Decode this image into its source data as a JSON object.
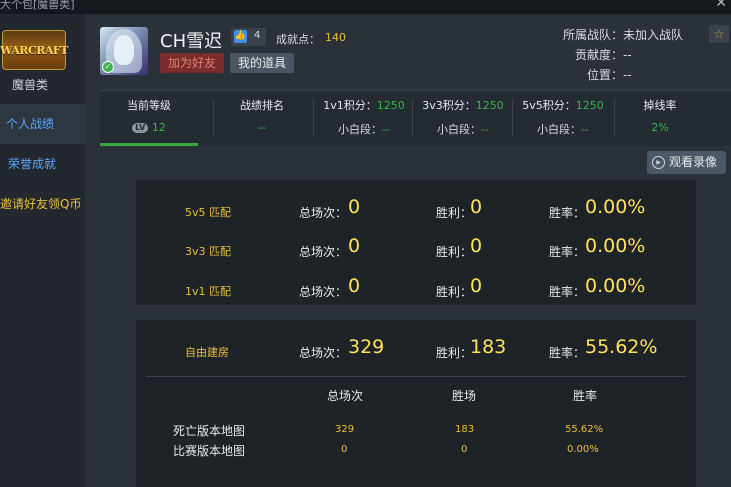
{
  "window": {
    "title": "大个包[魔兽类]",
    "close": "✕"
  },
  "sidebar": {
    "logo_text": "WARCRAFT",
    "game": "魔兽类",
    "items": [
      {
        "label": "个人战绩"
      },
      {
        "label": "荣誉成就"
      },
      {
        "label": "邀请好友领Q币"
      }
    ]
  },
  "profile": {
    "username": "CH雪迟",
    "likes": "4",
    "achievement_label": "成就点：",
    "achievement_value": "140",
    "add_friend": "加为好友",
    "my_items": "我的道具",
    "team": "所属战队：未加入战队",
    "contribution": "贡献度：--",
    "position": "位置：--"
  },
  "stats": {
    "level": {
      "label": "当前等级",
      "badge": "LV",
      "value": "12"
    },
    "ranking": {
      "label": "战绩排名",
      "value": "--"
    },
    "v1": {
      "label": "1v1积分：",
      "score": "1250",
      "rank_label": "小白段：",
      "rank": "--"
    },
    "v3": {
      "label": "3v3积分：",
      "score": "1250",
      "rank_label": "小白段：",
      "rank": "--"
    },
    "v5": {
      "label": "5v5积分：",
      "score": "1250",
      "rank_label": "小白段：",
      "rank": "--"
    },
    "drop": {
      "label": "掉线率",
      "value": "2%"
    }
  },
  "watch_replay": "观看录像",
  "matches": [
    {
      "mode": "5v5 匹配",
      "total_label": "总场次：",
      "total": "0",
      "win_label": "胜利：",
      "win": "0",
      "rate_label": "胜率：",
      "rate": "0.00%"
    },
    {
      "mode": "3v3 匹配",
      "total_label": "总场次：",
      "total": "0",
      "win_label": "胜利：",
      "win": "0",
      "rate_label": "胜率：",
      "rate": "0.00%"
    },
    {
      "mode": "1v1 匹配",
      "total_label": "总场次：",
      "total": "0",
      "win_label": "胜利：",
      "win": "0",
      "rate_label": "胜率：",
      "rate": "0.00%"
    }
  ],
  "free_room": {
    "mode": "自由建房",
    "total_label": "总场次：",
    "total": "329",
    "win_label": "胜利：",
    "win": "183",
    "rate_label": "胜率：",
    "rate": "55.62%"
  },
  "maps": {
    "columns": [
      "总场次",
      "胜场",
      "胜率"
    ],
    "rows": [
      {
        "name": "死亡版本地图",
        "total": "329",
        "wins": "183",
        "rate": "55.62%"
      },
      {
        "name": "比赛版本地图",
        "total": "0",
        "wins": "0",
        "rate": "0.00%"
      }
    ]
  }
}
